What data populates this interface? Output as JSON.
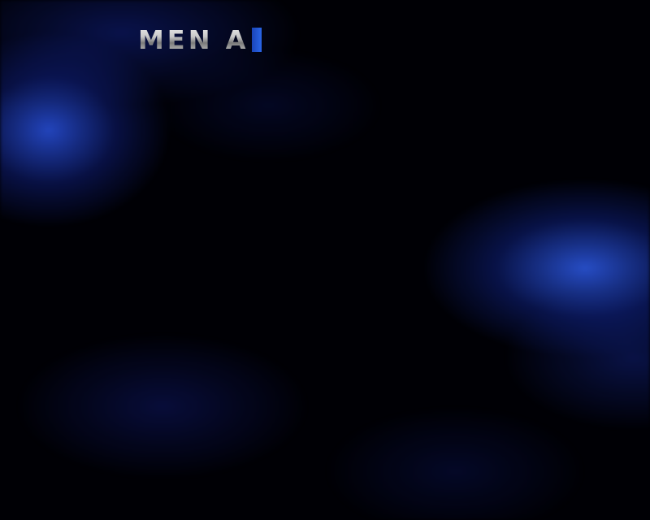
{
  "title": {
    "text": "MEN A",
    "cursor_visible": true
  }
}
